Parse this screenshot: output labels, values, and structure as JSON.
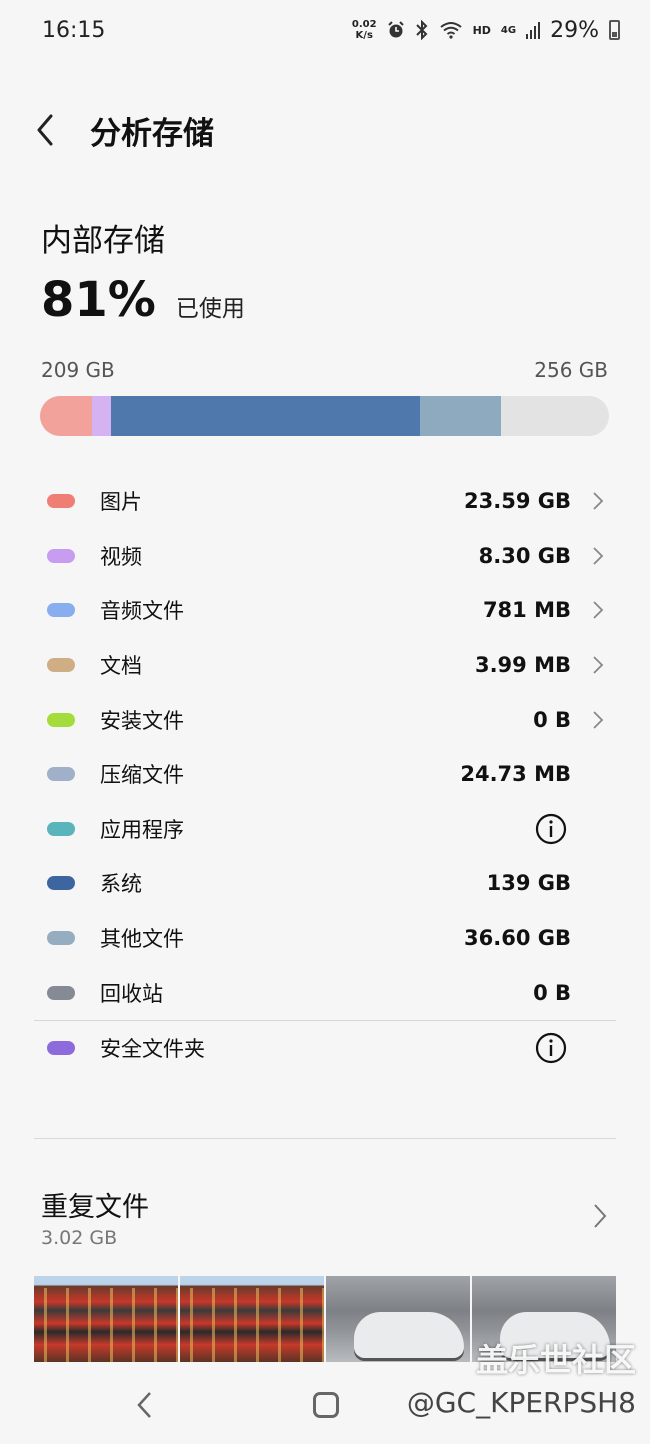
{
  "status_bar": {
    "time": "16:15",
    "net_speed_top": "0.02",
    "net_speed_bottom": "K/s",
    "network_type": "HD",
    "cell_type": "4G",
    "battery": "29%",
    "icons": [
      "alarm-icon",
      "bluetooth-icon",
      "wifi-icon",
      "signal-icon",
      "battery-icon"
    ]
  },
  "header": {
    "title": "分析存储"
  },
  "storage": {
    "title": "内部存储",
    "percent": "81%",
    "used_label": "已使用",
    "used": "209 GB",
    "total": "256 GB",
    "bar_segments": [
      {
        "category": "图片",
        "fraction": 0.092,
        "color": "#f2a29a"
      },
      {
        "category": "视频",
        "fraction": 0.032,
        "color": "#d5b3f2"
      },
      {
        "category": "系统",
        "fraction": 0.543,
        "color": "#4f79ad"
      },
      {
        "category": "其他文件",
        "fraction": 0.143,
        "color": "#8eaabe"
      }
    ],
    "bar_background": "#e3e3e3"
  },
  "categories": [
    {
      "name": "图片",
      "size": "23.59 GB",
      "color": "#ef7e75",
      "action": "chevron"
    },
    {
      "name": "视频",
      "size": "8.30 GB",
      "color": "#c89cf0",
      "action": "chevron"
    },
    {
      "name": "音频文件",
      "size": "781 MB",
      "color": "#89aef0",
      "action": "chevron"
    },
    {
      "name": "文档",
      "size": "3.99 MB",
      "color": "#cfae85",
      "action": "chevron"
    },
    {
      "name": "安装文件",
      "size": "0 B",
      "color": "#a4dc3c",
      "action": "chevron"
    },
    {
      "name": "压缩文件",
      "size": "24.73 MB",
      "color": "#9fb0c8",
      "action": "none"
    },
    {
      "name": "应用程序",
      "size": "",
      "color": "#5ab4bc",
      "action": "info"
    },
    {
      "name": "系统",
      "size": "139 GB",
      "color": "#3d66a0",
      "action": "none"
    },
    {
      "name": "其他文件",
      "size": "36.60 GB",
      "color": "#96adbf",
      "action": "none"
    },
    {
      "name": "回收站",
      "size": "0 B",
      "color": "#858a94",
      "action": "none"
    }
  ],
  "secure_folder": {
    "name": "安全文件夹",
    "color": "#8d6bdc",
    "action": "info"
  },
  "duplicates": {
    "title": "重复文件",
    "size": "3.02 GB"
  },
  "watermark": "盖乐世社区",
  "credit": "@GC_KPERPSH8"
}
